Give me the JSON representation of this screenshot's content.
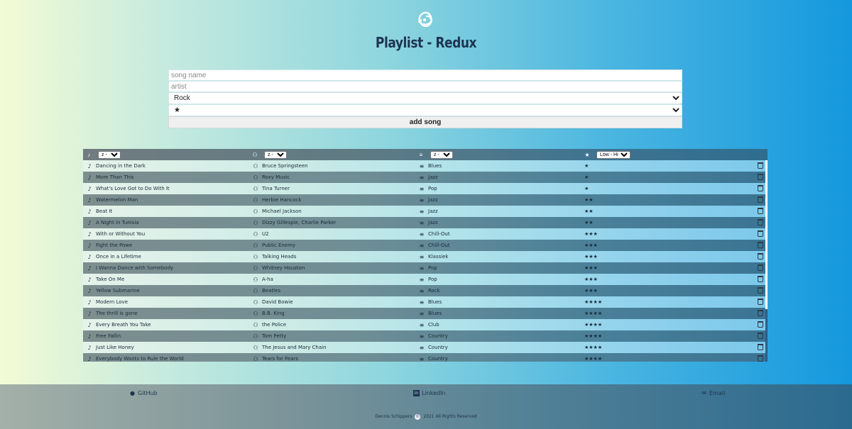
{
  "app": {
    "title": "Playlist - Redux",
    "logo_icon": "redux-logo-icon"
  },
  "form": {
    "song_placeholder": "song name",
    "artist_placeholder": "artist",
    "genre_selected": "Rock",
    "rating_selected": "★",
    "submit_label": "add song"
  },
  "table": {
    "headers": {
      "title_sort": "z - a",
      "artist_sort": "z - a",
      "genre_sort": "z - a",
      "rating_sort": "Low - High"
    },
    "rows": [
      {
        "title": "Dancing in the Dark",
        "artist": "Bruce Springsteen",
        "genre": "Blues",
        "rating": "★"
      },
      {
        "title": "More Than This",
        "artist": "Roxy Music",
        "genre": "Jazz",
        "rating": "★"
      },
      {
        "title": "What's Love Got to Do With It",
        "artist": "Tina Turner",
        "genre": "Pop",
        "rating": "★"
      },
      {
        "title": "Watermelon Man",
        "artist": "Herbie Hancock",
        "genre": "Jazz",
        "rating": "★★"
      },
      {
        "title": "Beat It",
        "artist": "Michael Jackson",
        "genre": "Jazz",
        "rating": "★★"
      },
      {
        "title": "A Night in Tunisia",
        "artist": "Dizzy Gillespie, Charlie Parker",
        "genre": "Jazz",
        "rating": "★★"
      },
      {
        "title": "With or Without You",
        "artist": "U2",
        "genre": "Chill-Out",
        "rating": "★★★"
      },
      {
        "title": "Fight the Powe",
        "artist": "Public Enemy",
        "genre": "Chill-Out",
        "rating": "★★★"
      },
      {
        "title": "Once in a Lifetime",
        "artist": "Talking Heads",
        "genre": "Klassiek",
        "rating": "★★★"
      },
      {
        "title": "I Wanna Dance with Somebody",
        "artist": "Whitney Houston",
        "genre": "Pop",
        "rating": "★★★"
      },
      {
        "title": "Take On Me",
        "artist": "A-ha",
        "genre": "Pop",
        "rating": "★★★"
      },
      {
        "title": "Yellow Submarine",
        "artist": "Beatles",
        "genre": "Rock",
        "rating": "★★★"
      },
      {
        "title": "Modern Love",
        "artist": "David Bowie",
        "genre": "Blues",
        "rating": "★★★★"
      },
      {
        "title": "The thrill is gone",
        "artist": "B.B. King",
        "genre": "Blues",
        "rating": "★★★★"
      },
      {
        "title": "Every Breath You Take",
        "artist": "the Police",
        "genre": "Club",
        "rating": "★★★★"
      },
      {
        "title": "Free Fallin",
        "artist": "Tom Petty",
        "genre": "Country",
        "rating": "★★★★"
      },
      {
        "title": "Just Like Honey",
        "artist": "The Jesus and Mary Chain",
        "genre": "Country",
        "rating": "★★★★"
      },
      {
        "title": "Everybody Wants to Rule the World",
        "artist": "Tears for Fears",
        "genre": "Country",
        "rating": "★★★★"
      }
    ]
  },
  "footer": {
    "github": "GitHub",
    "linkedin": "LinkedIn",
    "email": "Email",
    "author": "Dennis Schippers",
    "copyright_symbol": "©",
    "rights": "2021 All Rights Reserved"
  }
}
